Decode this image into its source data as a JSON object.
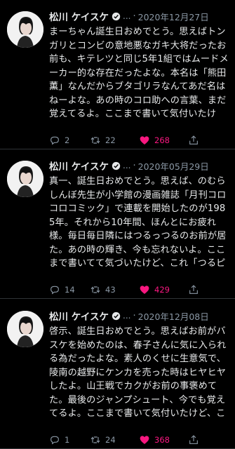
{
  "tweets": [
    {
      "name": "松川 ケイスケ",
      "dots": "...",
      "sep": "·",
      "date": "2020年12月27日",
      "text": "まーちゃん誕生日おめでとう。思えばトンガリとコンビの意地悪なガキ大将だったお前も、キテレツと同じ5年1組ではムードメーカー的な存在だったよな。本名は「熊田薫」なんだからブタゴリラなんてあだ名はねーよな。あの時のコロ助への言葉、まだ覚えてるよ。ここまで書いて気付いたけど、これキテレツ",
      "replies": "2",
      "retweets": "22",
      "likes": "268"
    },
    {
      "name": "松川 ケイスケ",
      "dots": "...",
      "sep": "·",
      "date": "2020年05月29日",
      "text": "真一、誕生日おめでとう。思えば、のむらしんぼ先生が小学館の漫画雑誌「月刊コロコロコミック」で連載を開始したのが1985年。それから10年間、ほんとにお疲れ様。毎日毎日隣にはつるっつるのお前が居た。あの時の輝き、今も忘れないよ。ここまで書いてて気づいたけど、これ「つるピカハゲ丸くん」のこ",
      "replies": "14",
      "retweets": "43",
      "likes": "429"
    },
    {
      "name": "松川 ケイスケ",
      "dots": "...",
      "sep": "·",
      "date": "2020年12月08日",
      "text": "啓示、誕生日おめでとう。思えばお前がバスケを始めたのは、春子さんに気に入られる為だったよな。素人のくせに生意気で、陵南の越野にケンカを売った時はヒヤヒヤしたよ。山王戦でカクがお前の事褒めてた。最後のジャンプシュート、今でも覚えてるよ。ここまで書いて気付いたけど、これスラムダンクの",
      "replies": "1",
      "retweets": "24",
      "likes": "368"
    }
  ],
  "icons": {
    "reply": "reply-icon",
    "retweet": "retweet-icon",
    "like": "heart-icon",
    "share": "share-icon",
    "verified": "verified-badge-icon"
  },
  "colors": {
    "background": "#000000",
    "text": "#e7e9ea",
    "muted": "#8b98a5",
    "like": "#f91880",
    "verified": "#1d9bf0"
  }
}
